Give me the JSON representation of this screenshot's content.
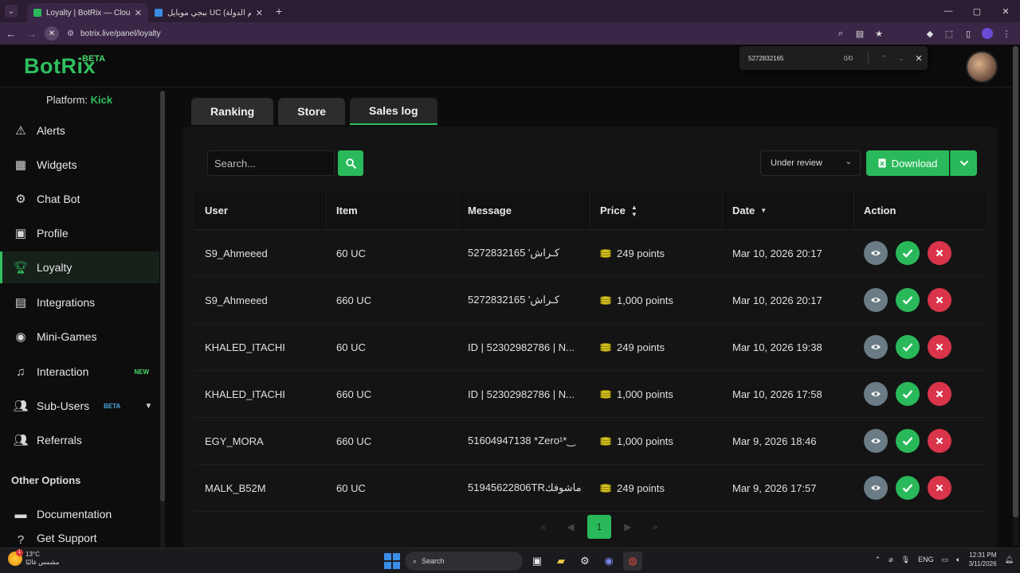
{
  "browser": {
    "tabs": [
      {
        "title": "Loyalty | BotRix — Cloud Strea",
        "active": true
      },
      {
        "title": "ببجي موبايل UC (اسم الدولة) | خـ",
        "active": false
      }
    ],
    "url": "botrix.live/panel/loyalty",
    "find": {
      "query": "5272832165",
      "count": "0/0"
    }
  },
  "header": {
    "logo": "BotRix",
    "logo_badge": "BETA"
  },
  "sidebar": {
    "platform_label": "Platform:",
    "platform_value": "Kick",
    "items": [
      {
        "label": "Alerts",
        "icon": "warning-icon"
      },
      {
        "label": "Widgets",
        "icon": "grid-icon"
      },
      {
        "label": "Chat Bot",
        "icon": "robot-icon"
      },
      {
        "label": "Profile",
        "icon": "id-card-icon"
      },
      {
        "label": "Loyalty",
        "icon": "trophy-icon"
      },
      {
        "label": "Integrations",
        "icon": "integrations-icon"
      },
      {
        "label": "Mini-Games",
        "icon": "gamepad-icon"
      },
      {
        "label": "Interaction",
        "icon": "music-icon",
        "badge": "NEW"
      },
      {
        "label": "Sub-Users",
        "icon": "users-icon",
        "badge": "BETA"
      },
      {
        "label": "Referrals",
        "icon": "referrals-icon"
      }
    ],
    "section_title": "Other Options",
    "other_items": [
      {
        "label": "Documentation",
        "icon": "book-icon"
      },
      {
        "label": "Get Support",
        "icon": "support-icon"
      }
    ]
  },
  "page_tabs": [
    "Ranking",
    "Store",
    "Sales log"
  ],
  "toolbar": {
    "search_placeholder": "Search...",
    "status_select": "Under review",
    "download_label": "Download"
  },
  "table": {
    "columns": [
      "User",
      "Item",
      "Message",
      "Price",
      "Date",
      "Action"
    ],
    "rows": [
      {
        "user": "S9_Ahmeeed",
        "item": "60 UC",
        "message": "5272832165 'كـراش",
        "price": "249 points",
        "date": "Mar 10, 2026 20:17"
      },
      {
        "user": "S9_Ahmeeed",
        "item": "660 UC",
        "message": "5272832165 'كـراش",
        "price": "1,000 points",
        "date": "Mar 10, 2026 20:17"
      },
      {
        "user": "KHALED_ITACHI",
        "item": "60 UC",
        "message": "ID | 52302982786 | N...",
        "price": "249 points",
        "date": "Mar 10, 2026 19:38"
      },
      {
        "user": "KHALED_ITACHI",
        "item": "660 UC",
        "message": "ID | 52302982786 | N...",
        "price": "1,000 points",
        "date": "Mar 10, 2026 17:58"
      },
      {
        "user": "EGY_MORA",
        "item": "660 UC",
        "message": "51604947138 *Zero¹*‿",
        "price": "1,000 points",
        "date": "Mar 9, 2026 18:46"
      },
      {
        "user": "MALK_B52M",
        "item": "60 UC",
        "message": "51945622806TRماشوفك",
        "price": "249 points",
        "date": "Mar 9, 2026 17:57"
      }
    ]
  },
  "pagination": {
    "current": "1"
  },
  "taskbar": {
    "temp": "13°C",
    "weather": "مشمس غالبًا",
    "search": "Search",
    "lang": "ENG",
    "time": "12:31 PM",
    "date": "3/11/2026"
  },
  "colors": {
    "accent": "#2ab95a",
    "danger": "#d9344a",
    "view": "#6b7c86"
  }
}
